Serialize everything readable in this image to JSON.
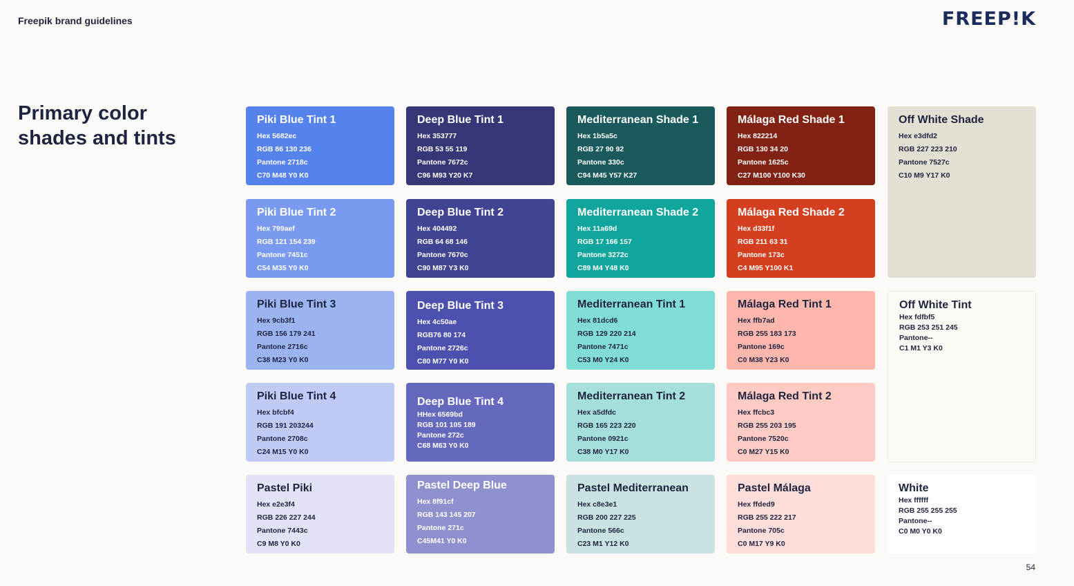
{
  "header": {
    "brand_title": "Freepik brand guidelines",
    "logo_text": "FREEP!K"
  },
  "title": {
    "line1": "Primary color",
    "line2": "shades and tints"
  },
  "page_number": "54",
  "swatches": [
    {
      "name": "Piki Blue Tint 1",
      "color": "#5682ec",
      "text_color": "light",
      "lines": [
        "Hex 5682ec",
        "RGB 86 130 236",
        "Pantone 2718c",
        "C70 M48 Y0 K0"
      ]
    },
    {
      "name": "Deep Blue Tint 1",
      "color": "#353777",
      "text_color": "light",
      "lines": [
        "Hex 353777",
        "RGB 53 55 119",
        "Pantone 7672c",
        "C96 M93 Y20 K7"
      ]
    },
    {
      "name": "Mediterranean Shade 1",
      "color": "#1b5a5c",
      "text_color": "light",
      "lines": [
        "Hex 1b5a5c",
        "RGB 27 90 92",
        "Pantone 330c",
        "C94 M45 Y57 K27"
      ]
    },
    {
      "name": "Málaga Red Shade 1",
      "color": "#822214",
      "text_color": "light",
      "lines": [
        "Hex 822214",
        "RGB 130 34 20",
        "Pantone 1625c",
        "C27 M100 Y100 K30"
      ]
    },
    {
      "name": "Off White Shade",
      "color": "#e3dfd2",
      "text_color": "dark",
      "lines": [
        "Hex e3dfd2",
        "RGB 227 223 210",
        "Pantone 7527c",
        "C10 M9 Y17 K0"
      ]
    },
    {
      "name": "Piki Blue Tint 2",
      "color": "#799aef",
      "text_color": "light",
      "lines": [
        "Hex 799aef",
        "RGB 121 154 239",
        "Pantone 7451c",
        "C54 M35 Y0 K0"
      ]
    },
    {
      "name": "Deep Blue Tint 2",
      "color": "#404492",
      "text_color": "light",
      "lines": [
        "Hex 404492",
        "RGB 64 68 146",
        "Pantone 7670c",
        "C90 M87 Y3 K0"
      ]
    },
    {
      "name": "Mediterranean Shade 2",
      "color": "#11a69d",
      "text_color": "light",
      "lines": [
        "Hex 11a69d",
        "RGB 17 166 157",
        "Pantone 3272c",
        "C89 M4 Y48 K0"
      ]
    },
    {
      "name": "Málaga Red Shade 2",
      "color": "#d33f1f",
      "text_color": "light",
      "lines": [
        "Hex d33f1f",
        "RGB 211 63 31",
        "Pantone 173c",
        "C4 M95 Y100 K1"
      ]
    },
    {
      "name": "Piki Blue Tint 3",
      "color": "#9cb3f1",
      "text_color": "dark",
      "lines": [
        "Hex 9cb3f1",
        "RGB 156 179 241",
        "Pantone 2716c",
        "C38 M23 Y0 K0"
      ]
    },
    {
      "name": "Deep Blue Tint 3",
      "color": "#4c50ae",
      "text_color": "light",
      "lines": [
        "Hex 4c50ae",
        "RGB76 80 174",
        "Pantone 2726c",
        "C80 M77 Y0 K0"
      ]
    },
    {
      "name": "Mediterranean Tint 1",
      "color": "#81dcd6",
      "text_color": "dark",
      "lines": [
        "Hex 81dcd6",
        "RGB 129 220 214",
        "Pantone 7471c",
        "C53 M0 Y24 K0"
      ]
    },
    {
      "name": "Málaga Red Tint 1",
      "color": "#ffb7ad",
      "text_color": "dark",
      "lines": [
        "Hex ffb7ad",
        "RGB 255 183 173",
        "Pantone 169c",
        "C0 M38 Y23 K0"
      ]
    },
    {
      "name": "Off White Tint",
      "color": "#fdfbf5",
      "text_color": "dark",
      "lines": [
        "Hex fdfbf5",
        "RGB 253 251 245",
        "Pantone--",
        "C1 M1 Y3 K0"
      ]
    },
    {
      "name": "Piki Blue Tint 4",
      "color": "#bfcbf4",
      "text_color": "dark",
      "lines": [
        "Hex bfcbf4",
        "RGB 191 203244",
        "Pantone 2708c",
        "C24 M15 Y0 K0"
      ]
    },
    {
      "name": "Deep Blue Tint 4",
      "color": "#6569bd",
      "text_color": "light",
      "lines": [
        "HHex 6569bd",
        "RGB 101 105 189",
        "Pantone 272c",
        "C68 M63 Y0 K0"
      ]
    },
    {
      "name": "Mediterranean Tint 2",
      "color": "#a5dfdc",
      "text_color": "dark",
      "lines": [
        "Hex a5dfdc",
        "RGB 165 223 220",
        "Pantone 0921c",
        "C38 M0 Y17 K0"
      ]
    },
    {
      "name": "Málaga Red Tint 2",
      "color": "#ffcbc3",
      "text_color": "dark",
      "lines": [
        "Hex ffcbc3",
        "RGB 255 203 195",
        "Pantone 7520c",
        "C0 M27 Y15 K0"
      ]
    },
    {
      "name": "Pastel Piki",
      "color": "#e2e3f4",
      "text_color": "dark",
      "lines": [
        "Hex e2e3f4",
        "RGB 226 227 244",
        "Pantone 7443c",
        "C9 M8 Y0 K0"
      ]
    },
    {
      "name": "Pastel Deep Blue",
      "color": "#8f91cf",
      "text_color": "light",
      "lines": [
        "Hex 8f91cf",
        "RGB 143 145 207",
        "Pantone 271c",
        "C45M41 Y0 K0"
      ]
    },
    {
      "name": "Pastel Mediterranean",
      "color": "#c8e3e1",
      "text_color": "dark",
      "lines": [
        "Hex c8e3e1",
        "RGB 200 227 225",
        "Pantone 566c",
        "C23 M1 Y12 K0"
      ]
    },
    {
      "name": "Pastel Málaga",
      "color": "#ffded9",
      "text_color": "dark",
      "lines": [
        "Hex ffded9",
        "RGB 255 222 217",
        "Pantone 705c",
        "C0 M17 Y9 K0"
      ]
    },
    {
      "name": "White",
      "color": "#ffffff",
      "text_color": "dark",
      "lines": [
        "Hex ffffff",
        "RGB 255 255 255",
        "Pantone--",
        "C0 M0 Y0 K0"
      ]
    }
  ]
}
